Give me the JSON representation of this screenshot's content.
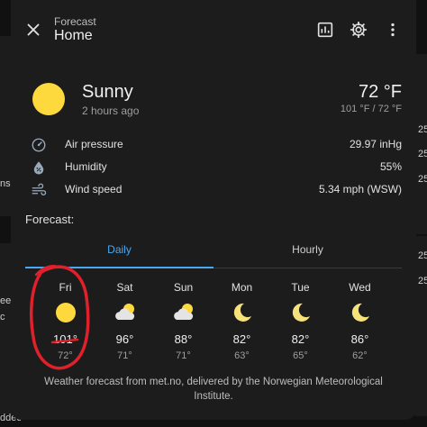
{
  "background_fragments": [
    "25",
    "25",
    "25",
    "ns",
    "ee",
    "c",
    "25",
    "25",
    "ddec"
  ],
  "header": {
    "subtitle": "Forecast",
    "title": "Home",
    "icons": [
      "close-icon",
      "chart-icon",
      "gear-icon",
      "more-vert-icon"
    ]
  },
  "current": {
    "condition": "Sunny",
    "updated": "2 hours ago",
    "temperature": "72 °F",
    "range": "101 °F / 72 °F",
    "icon": "sun-icon"
  },
  "attributes": [
    {
      "label": "Air pressure",
      "value": "29.97 inHg",
      "icon": "gauge-icon"
    },
    {
      "label": "Humidity",
      "value": "55%",
      "icon": "water-percent-icon"
    },
    {
      "label": "Wind speed",
      "value": "5.34 mph (WSW)",
      "icon": "wind-icon"
    }
  ],
  "forecast": {
    "title": "Forecast:",
    "tabs": [
      {
        "label": "Daily",
        "active": true
      },
      {
        "label": "Hourly",
        "active": false
      }
    ],
    "days": [
      {
        "name": "Fri",
        "icon": "sun-icon",
        "hi": "101°",
        "lo": "72°"
      },
      {
        "name": "Sat",
        "icon": "partly-cloudy-icon",
        "hi": "96°",
        "lo": "71°"
      },
      {
        "name": "Sun",
        "icon": "partly-cloudy-icon",
        "hi": "88°",
        "lo": "71°"
      },
      {
        "name": "Mon",
        "icon": "moon-icon",
        "hi": "82°",
        "lo": "63°"
      },
      {
        "name": "Tue",
        "icon": "moon-icon",
        "hi": "82°",
        "lo": "65°"
      },
      {
        "name": "Wed",
        "icon": "moon-icon",
        "hi": "86°",
        "lo": "62°"
      }
    ]
  },
  "attribution": "Weather forecast from met.no, delivered by the Norwegian Meteorological Institute.",
  "colors": {
    "accent": "#4aa8f0",
    "sun": "#fdd93d",
    "annotation": "#e0202a",
    "dialog_bg": "#1c1c1c"
  }
}
